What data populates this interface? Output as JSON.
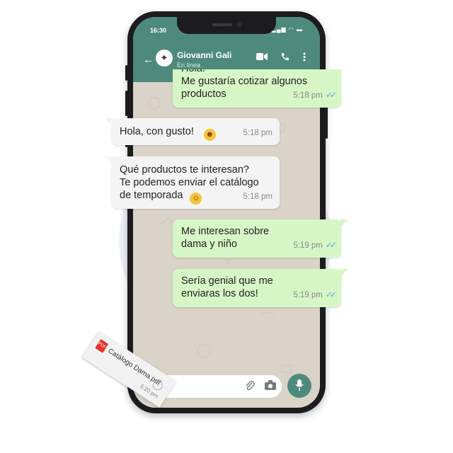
{
  "status_bar": {
    "time": "16:30",
    "icons": "▂▄▆ ◠ ▬"
  },
  "header": {
    "back_icon": "arrow-left-icon",
    "contact_name": "Giovanni Gali",
    "contact_status": "En línea",
    "avatar_icon": "deer-icon",
    "actions": [
      "video-call-icon",
      "phone-icon",
      "more-options-icon"
    ]
  },
  "messages": [
    {
      "direction": "out",
      "partial_text": "Hola!",
      "text": "Me gustaría  cotizar algunos productos",
      "line1": "Me gustaría  cotizar algunos",
      "line2": "productos",
      "time": "5:18 pm",
      "read": true
    },
    {
      "direction": "in",
      "text": "Hola, con gusto!",
      "emoji": "grinning-face",
      "time": "5:18 pm"
    },
    {
      "direction": "in",
      "line1": "Qué productos te interesan?",
      "line2": "Te podemos enviar el catálogo",
      "line3": "de temporada",
      "emoji": "smiling-face",
      "time": "5:18 pm"
    },
    {
      "direction": "out",
      "line1": "Me interesan sobre",
      "line2": "dama y niño",
      "time": "5:19 pm",
      "read": true
    },
    {
      "direction": "out",
      "line1": "Sería genial que me",
      "line2": "enviaras los dos!",
      "time": "5:19 pm",
      "read": true
    }
  ],
  "attachment": {
    "file_name": "Catálogo Dama.pdf",
    "file_type": "PDF",
    "time": "5:20 pm",
    "icon": "pdf-icon"
  },
  "input_bar": {
    "emoji_icon": "emoji-icon",
    "attach_icon": "paperclip-icon",
    "camera_icon": "camera-icon",
    "mic_icon": "microphone-icon"
  },
  "colors": {
    "header": "#4e8a7b",
    "outgoing_bubble": "#d6f7c5",
    "incoming_bubble": "#f4f4f4",
    "read_ticks": "#5aa6e6",
    "wallpaper": "#d9d3c9"
  }
}
